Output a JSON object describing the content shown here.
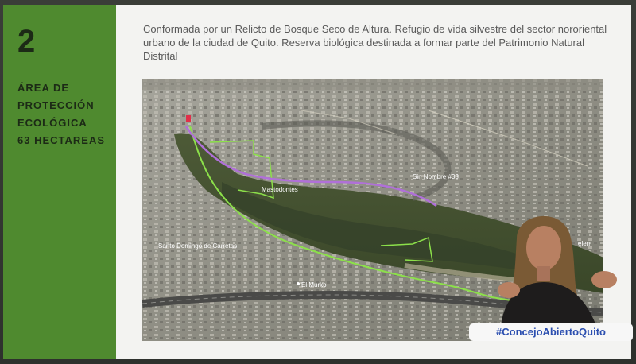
{
  "slide": {
    "number": "2",
    "area_title_lines": [
      "ÁREA DE",
      "PROTECCIÓN",
      "ECOLÓGICA",
      "63 HECTAREAS"
    ],
    "description": "Conformada por un Relicto de Bosque Seco de Altura. Refugio de vida silvestre del sector nororiental urbano de la ciudad de Quito. Reserva biológica destinada a formar parte del Patrimonio Natural Distrital"
  },
  "map": {
    "labels": {
      "mastodontes": "Mastodontes",
      "santo_domingo": "Santo Domingo de Carretas",
      "el_murko": "El Murko",
      "nombre": "Sin Nombre #33",
      "belen": "elen"
    }
  },
  "broadcast": {
    "hashtag": "#ConcejoAbiertoQuito"
  },
  "colors": {
    "sidebar_green": "#4f8a2f",
    "boundary_green": "#8ce04a",
    "route_purple": "#b070d8",
    "hashtag_blue": "#2c4fb0"
  }
}
